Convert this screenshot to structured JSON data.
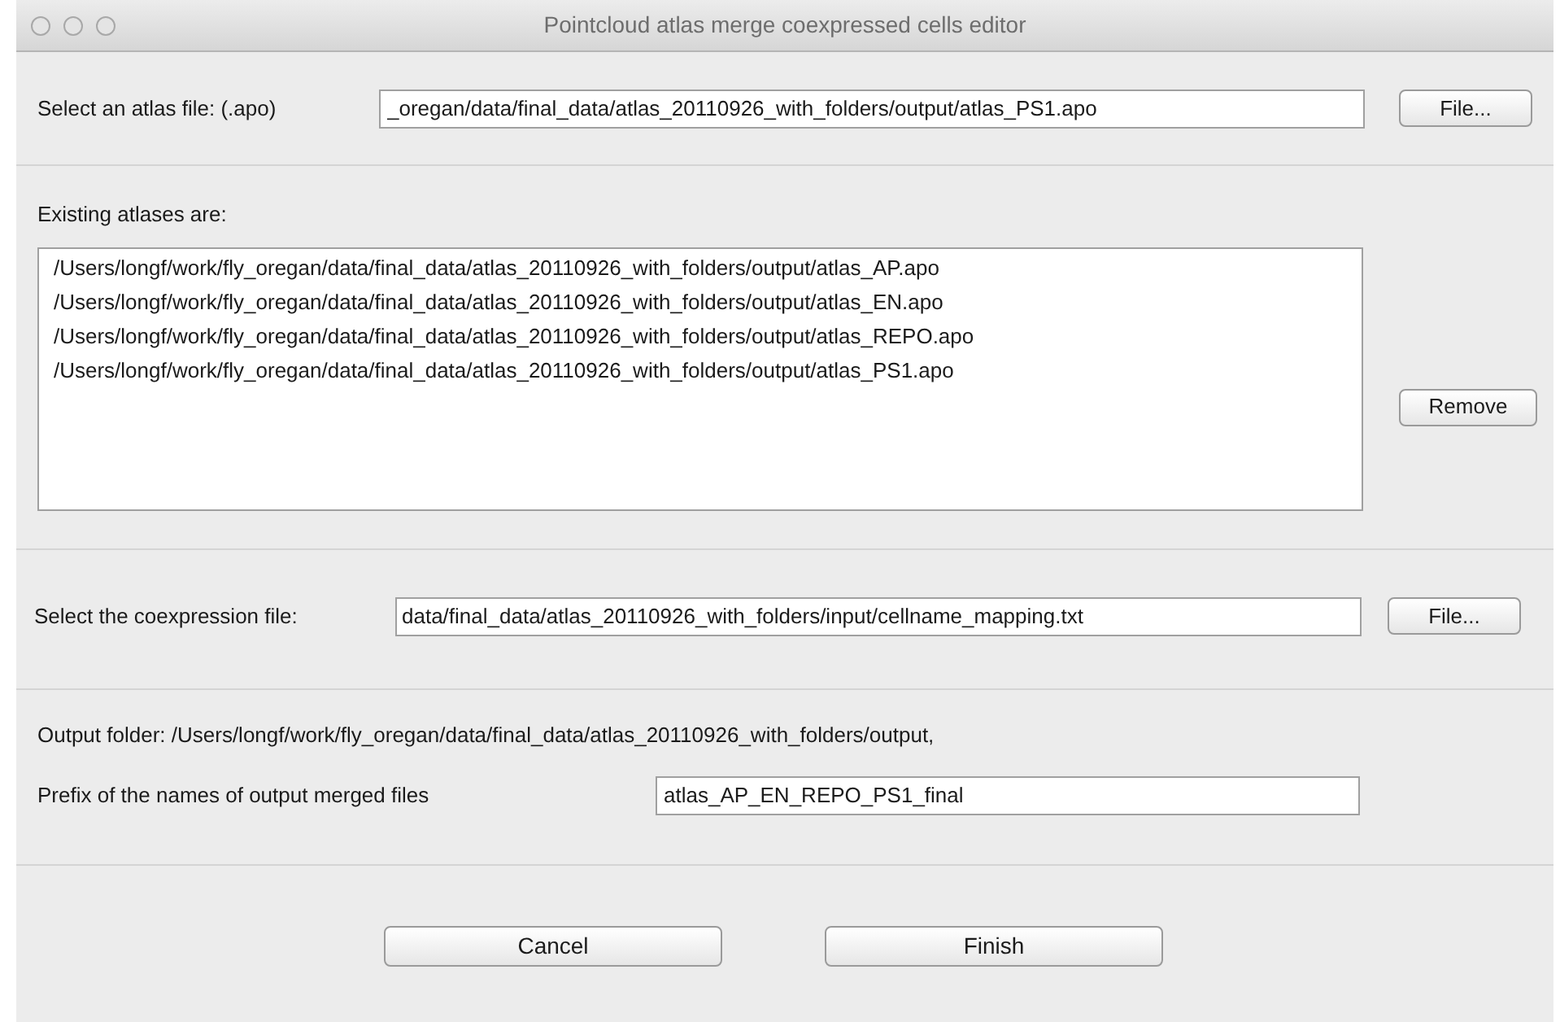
{
  "window": {
    "title": "Pointcloud atlas merge coexpressed cells editor"
  },
  "atlas_file": {
    "label": "Select an atlas file: (.apo)",
    "value": "_oregan/data/final_data/atlas_20110926_with_folders/output/atlas_PS1.apo",
    "button": "File..."
  },
  "existing": {
    "label": "Existing atlases are:",
    "items": [
      {
        "text": "/Users/longf/work/fly_oregan/data/final_data/atlas_20110926_with_folders/output/atlas_AP.apo"
      },
      {
        "text": "/Users/longf/work/fly_oregan/data/final_data/atlas_20110926_with_folders/output/atlas_EN.apo"
      },
      {
        "text": "/Users/longf/work/fly_oregan/data/final_data/atlas_20110926_with_folders/output/atlas_REPO.apo"
      },
      {
        "text": "/Users/longf/work/fly_oregan/data/final_data/atlas_20110926_with_folders/output/atlas_PS1.apo"
      }
    ],
    "button": "Remove"
  },
  "coexpression_file": {
    "label": "Select the coexpression file:",
    "value": "data/final_data/atlas_20110926_with_folders/input/cellname_mapping.txt",
    "button": "File..."
  },
  "output_folder": {
    "text": "Output folder: /Users/longf/work/fly_oregan/data/final_data/atlas_20110926_with_folders/output,"
  },
  "prefix": {
    "label": "Prefix of the names of output merged files",
    "value": "atlas_AP_EN_REPO_PS1_final"
  },
  "buttons": [
    "Cancel",
    "Finish"
  ]
}
